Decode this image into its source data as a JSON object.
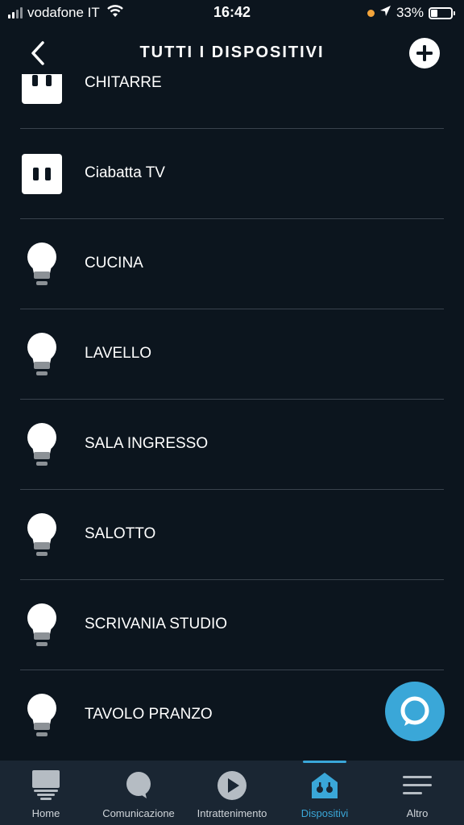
{
  "status_bar": {
    "carrier": "vodafone IT",
    "time": "16:42",
    "battery_percent": "33%",
    "battery_level": 0.33
  },
  "header": {
    "title": "TUTTI I DISPOSITIVI",
    "back_icon": "chevron-left-icon",
    "add_icon": "plus-icon"
  },
  "devices": [
    {
      "label": "CHITARRE",
      "icon": "smart-plug-icon"
    },
    {
      "label": "Ciabatta TV",
      "icon": "smart-plug-icon"
    },
    {
      "label": "CUCINA",
      "icon": "light-bulb-icon"
    },
    {
      "label": "LAVELLO",
      "icon": "light-bulb-icon"
    },
    {
      "label": "SALA INGRESSO",
      "icon": "light-bulb-icon"
    },
    {
      "label": "SALOTTO",
      "icon": "light-bulb-icon"
    },
    {
      "label": "SCRIVANIA STUDIO",
      "icon": "light-bulb-icon"
    },
    {
      "label": "TAVOLO PRANZO",
      "icon": "light-bulb-icon"
    }
  ],
  "alexa_button": {
    "icon": "alexa-ring-icon"
  },
  "bottom_nav": {
    "active": "Dispositivi",
    "items": [
      {
        "label": "Home",
        "icon": "home-icon"
      },
      {
        "label": "Comunicazione",
        "icon": "chat-bubble-icon"
      },
      {
        "label": "Intrattenimento",
        "icon": "play-icon"
      },
      {
        "label": "Dispositivi",
        "icon": "smart-home-icon"
      },
      {
        "label": "Altro",
        "icon": "menu-icon"
      }
    ]
  },
  "colors": {
    "background": "#0c151e",
    "accent": "#3aa7d8",
    "nav_background": "#1a2633",
    "divider": "#3a434d"
  }
}
